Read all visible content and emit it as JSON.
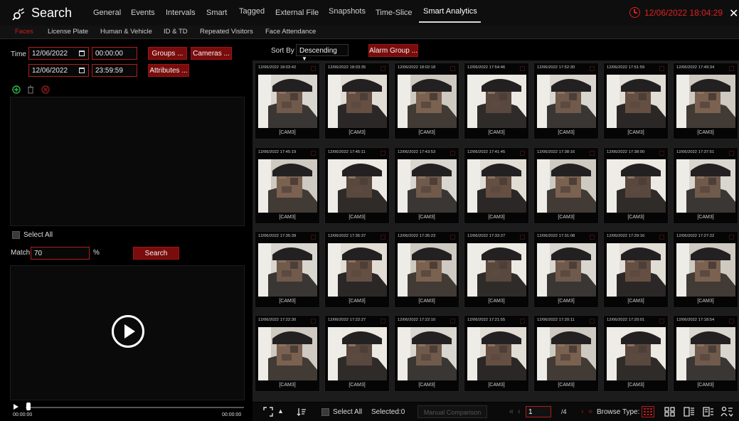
{
  "header": {
    "title": "Search",
    "tabs": [
      {
        "label": "General"
      },
      {
        "label": "Events"
      },
      {
        "label": "Intervals"
      },
      {
        "label": "Smart"
      },
      {
        "label": "Tagged"
      },
      {
        "label": "External File"
      },
      {
        "label": "Snapshots"
      },
      {
        "label": "Time-Slice"
      },
      {
        "label": "Smart Analytics"
      }
    ],
    "active_tab": "Smart Analytics",
    "datetime": "12/06/2022 18:04:29",
    "close_glyph": "✕",
    "accent_color": "#e02020"
  },
  "subtabs": {
    "items": [
      {
        "label": "Faces"
      },
      {
        "label": "License Plate"
      },
      {
        "label": "Human & Vehicle"
      },
      {
        "label": "ID & TD"
      },
      {
        "label": "Repeated Visitors"
      },
      {
        "label": "Face Attendance"
      }
    ],
    "active": "Faces"
  },
  "left": {
    "time_label": "Time",
    "start_date": "12/06/2022",
    "start_time": "00:00:00",
    "end_date": "12/06/2022",
    "end_time": "23:59:59",
    "groups_btn": "Groups ...",
    "cameras_btn": "Cameras ...",
    "attributes_btn": "Attributes ...",
    "icons": [
      "add-icon",
      "trash-icon",
      "delete-icon"
    ],
    "select_all": "Select All",
    "match_label": "Match",
    "match_value": "70",
    "match_unit": "%",
    "search_btn": "Search",
    "time_start": "00:00:00",
    "time_end": "00:00:00"
  },
  "sortbar": {
    "sort_label": "Sort By",
    "sort_value": "Descending",
    "sort_caret": "▼",
    "alarm_group_btn": "Alarm Group ..."
  },
  "thumbs": [
    {
      "time": "12/06/2022 18:03:42",
      "cam": "[CAM3]"
    },
    {
      "time": "12/06/2022 18:03:35",
      "cam": "[CAM3]"
    },
    {
      "time": "12/06/2022 18:02:18",
      "cam": "[CAM3]"
    },
    {
      "time": "12/06/2022 17:54:46",
      "cam": "[CAM3]"
    },
    {
      "time": "12/06/2022 17:52:30",
      "cam": "[CAM3]"
    },
    {
      "time": "12/06/2022 17:51:59",
      "cam": "[CAM3]"
    },
    {
      "time": "12/06/2022 17:49:34",
      "cam": "[CAM3]"
    },
    {
      "time": "12/06/2022 17:45:19",
      "cam": "[CAM3]"
    },
    {
      "time": "12/06/2022 17:45:11",
      "cam": "[CAM3]"
    },
    {
      "time": "12/06/2022 17:43:53",
      "cam": "[CAM3]"
    },
    {
      "time": "12/06/2022 17:41:45",
      "cam": "[CAM3]"
    },
    {
      "time": "12/06/2022 17:38:16",
      "cam": "[CAM3]"
    },
    {
      "time": "12/06/2022 17:38:00",
      "cam": "[CAM3]"
    },
    {
      "time": "12/06/2022 17:37:51",
      "cam": "[CAM3]"
    },
    {
      "time": "12/06/2022 17:35:39",
      "cam": "[CAM3]"
    },
    {
      "time": "12/06/2022 17:35:37",
      "cam": "[CAM3]"
    },
    {
      "time": "12/06/2022 17:35:23",
      "cam": "[CAM3]"
    },
    {
      "time": "12/06/2022 17:33:27",
      "cam": "[CAM3]"
    },
    {
      "time": "12/06/2022 17:31:08",
      "cam": "[CAM3]"
    },
    {
      "time": "12/06/2022 17:29:16",
      "cam": "[CAM3]"
    },
    {
      "time": "12/06/2022 17:27:22",
      "cam": "[CAM3]"
    },
    {
      "time": "12/06/2022 17:22:30",
      "cam": "[CAM3]"
    },
    {
      "time": "12/06/2022 17:22:27",
      "cam": "[CAM3]"
    },
    {
      "time": "12/06/2022 17:22:10",
      "cam": "[CAM3]"
    },
    {
      "time": "12/06/2022 17:21:55",
      "cam": "[CAM3]"
    },
    {
      "time": "12/06/2022 17:20:11",
      "cam": "[CAM3]"
    },
    {
      "time": "12/06/2022 17:20:01",
      "cam": "[CAM3]"
    },
    {
      "time": "12/06/2022 17:18:54",
      "cam": "[CAM3]"
    }
  ],
  "bottom": {
    "select_all": "Select All",
    "selected": "Selected:0",
    "manual_comparison": "Manual Comparison",
    "page_value": "1",
    "page_total": "/4",
    "browse_type": "Browse Type:",
    "first_glyph": "«",
    "prev_glyph": "‹",
    "next_glyph": "›",
    "last_glyph": "»",
    "up_glyph": "▲"
  }
}
